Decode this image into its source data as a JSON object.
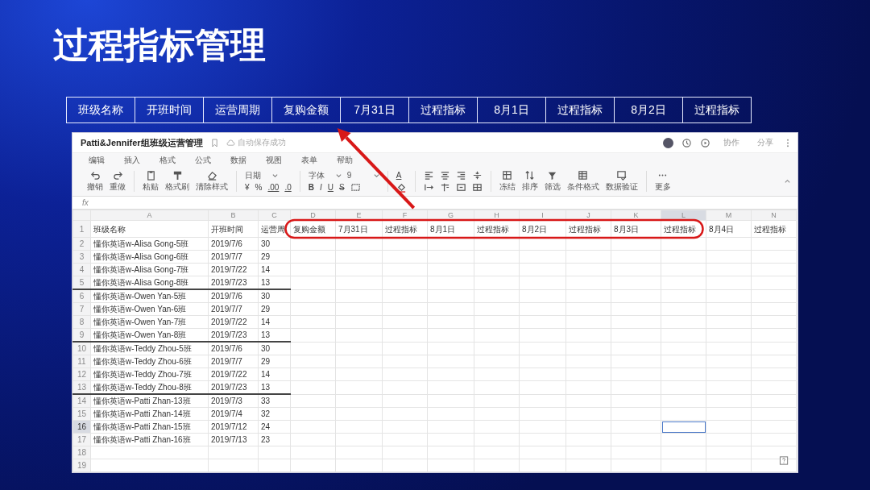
{
  "slide_title": "过程指标管理",
  "header_chips": [
    "班级名称",
    "开班时间",
    "运营周期",
    "复购金额",
    "7月31日",
    "过程指标",
    "8月1日",
    "过程指标",
    "8月2日",
    "过程指标"
  ],
  "spreadsheet": {
    "title": "Patti&Jennifer组班级运营管理",
    "save_status": "自动保存成功",
    "actions": [
      "协作",
      "分享"
    ],
    "menu": [
      "编辑",
      "插入",
      "格式",
      "公式",
      "数据",
      "视图",
      "表单",
      "帮助"
    ],
    "toolbar": [
      {
        "kind": "tools",
        "items": [
          {
            "kind": "undo",
            "label": "撤销"
          },
          {
            "kind": "redo",
            "label": "重做"
          }
        ]
      },
      {
        "kind": "tools",
        "items": [
          {
            "kind": "paste",
            "label": "粘贴"
          },
          {
            "kind": "brush",
            "label": "格式刷"
          },
          {
            "kind": "eraser",
            "label": "清除样式"
          }
        ]
      },
      {
        "kind": "stack",
        "top": [
          {
            "kind": "select",
            "value": "日期"
          }
        ],
        "bottom": [
          {
            "kind": "plain",
            "text": "¥"
          },
          {
            "kind": "plain",
            "text": "%"
          },
          {
            "kind": "underline",
            "text": ".00"
          },
          {
            "kind": "underline",
            "text": ".0"
          }
        ]
      },
      {
        "kind": "stack",
        "top": [
          {
            "kind": "select",
            "value": "字体"
          },
          {
            "kind": "select",
            "value": "9"
          }
        ],
        "bottom": [
          {
            "kind": "bold",
            "text": "B"
          },
          {
            "kind": "italic",
            "text": "I"
          },
          {
            "kind": "underline",
            "text": "U"
          },
          {
            "kind": "strike",
            "text": "S"
          },
          {
            "kind": "border"
          }
        ]
      },
      {
        "kind": "stack",
        "top": [
          {
            "kind": "underline",
            "text": "A"
          }
        ],
        "bottom": [
          {
            "kind": "fill"
          }
        ]
      },
      {
        "kind": "stack",
        "top": [
          {
            "kind": "alignleft"
          },
          {
            "kind": "aligncenter"
          },
          {
            "kind": "alignright"
          },
          {
            "kind": "valign"
          }
        ],
        "bottom": [
          {
            "kind": "indent"
          },
          {
            "kind": "wrap"
          },
          {
            "kind": "merge"
          },
          {
            "kind": "grid"
          }
        ]
      },
      {
        "kind": "tools",
        "items": [
          {
            "kind": "freeze",
            "label": "冻结"
          },
          {
            "kind": "sort",
            "label": "排序"
          },
          {
            "kind": "filter",
            "label": "筛选"
          },
          {
            "kind": "condfmt",
            "label": "条件格式"
          },
          {
            "kind": "validate",
            "label": "数据验证"
          }
        ]
      },
      {
        "kind": "tools",
        "items": [
          {
            "kind": "more",
            "label": "更多"
          }
        ]
      }
    ],
    "formula_label": "fx",
    "columns": [
      {
        "label": "A",
        "selected": false
      },
      {
        "label": "B",
        "selected": false
      },
      {
        "label": "C",
        "selected": false
      },
      {
        "label": "D",
        "selected": false
      },
      {
        "label": "E",
        "selected": false
      },
      {
        "label": "F",
        "selected": false
      },
      {
        "label": "G",
        "selected": false
      },
      {
        "label": "H",
        "selected": false
      },
      {
        "label": "I",
        "selected": false
      },
      {
        "label": "J",
        "selected": false
      },
      {
        "label": "K",
        "selected": false
      },
      {
        "label": "L",
        "selected": true
      },
      {
        "label": "M",
        "selected": false
      },
      {
        "label": "N",
        "selected": false
      }
    ],
    "rows": [
      {
        "number": "1",
        "selected": false,
        "divider_below": false,
        "cells": [
          "班级名称",
          "开班时间",
          "运营周",
          "复购金额",
          "7月31日",
          "过程指标",
          "8月1日",
          "过程指标",
          "8月2日",
          "过程指标",
          "8月3日",
          "过程指标",
          "8月4日",
          "过程指标"
        ]
      },
      {
        "number": "2",
        "selected": false,
        "divider_below": false,
        "cells": [
          "懂你英语w-Alisa Gong-5班",
          "2019/7/6",
          "30"
        ]
      },
      {
        "number": "3",
        "selected": false,
        "divider_below": false,
        "cells": [
          "懂你英语w-Alisa Gong-6班",
          "2019/7/7",
          "29"
        ]
      },
      {
        "number": "4",
        "selected": false,
        "divider_below": false,
        "cells": [
          "懂你英语w-Alisa Gong-7班",
          "2019/7/22",
          "14"
        ]
      },
      {
        "number": "5",
        "selected": false,
        "divider_below": true,
        "cells": [
          "懂你英语w-Alisa Gong-8班",
          "2019/7/23",
          "13"
        ]
      },
      {
        "number": "6",
        "selected": false,
        "divider_below": false,
        "cells": [
          "懂你英语w-Owen Yan-5班",
          "2019/7/6",
          "30"
        ]
      },
      {
        "number": "7",
        "selected": false,
        "divider_below": false,
        "cells": [
          "懂你英语w-Owen Yan-6班",
          "2019/7/7",
          "29"
        ]
      },
      {
        "number": "8",
        "selected": false,
        "divider_below": false,
        "cells": [
          "懂你英语w-Owen Yan-7班",
          "2019/7/22",
          "14"
        ]
      },
      {
        "number": "9",
        "selected": false,
        "divider_below": true,
        "cells": [
          "懂你英语w-Owen Yan-8班",
          "2019/7/23",
          "13"
        ]
      },
      {
        "number": "10",
        "selected": false,
        "divider_below": false,
        "cells": [
          "懂你英语w-Teddy Zhou-5班",
          "2019/7/6",
          "30"
        ]
      },
      {
        "number": "11",
        "selected": false,
        "divider_below": false,
        "cells": [
          "懂你英语w-Teddy Zhou-6班",
          "2019/7/7",
          "29"
        ]
      },
      {
        "number": "12",
        "selected": false,
        "divider_below": false,
        "cells": [
          "懂你英语w-Teddy Zhou-7班",
          "2019/7/22",
          "14"
        ]
      },
      {
        "number": "13",
        "selected": false,
        "divider_below": true,
        "cells": [
          "懂你英语w-Teddy Zhou-8班",
          "2019/7/23",
          "13"
        ]
      },
      {
        "number": "14",
        "selected": false,
        "divider_below": false,
        "cells": [
          "懂你英语w-Patti Zhan-13班",
          "2019/7/3",
          "33"
        ]
      },
      {
        "number": "15",
        "selected": false,
        "divider_below": false,
        "cells": [
          "懂你英语w-Patti Zhan-14班",
          "2019/7/4",
          "32"
        ]
      },
      {
        "number": "16",
        "selected": true,
        "divider_below": false,
        "cells": [
          "懂你英语w-Patti Zhan-15班",
          "2019/7/12",
          "24"
        ]
      },
      {
        "number": "17",
        "selected": false,
        "divider_below": false,
        "cells": [
          "懂你英语w-Patti Zhan-16班",
          "2019/7/13",
          "23"
        ]
      },
      {
        "number": "18",
        "selected": false,
        "divider_below": false,
        "cells": []
      },
      {
        "number": "19",
        "selected": false,
        "divider_below": false,
        "cells": []
      }
    ]
  }
}
